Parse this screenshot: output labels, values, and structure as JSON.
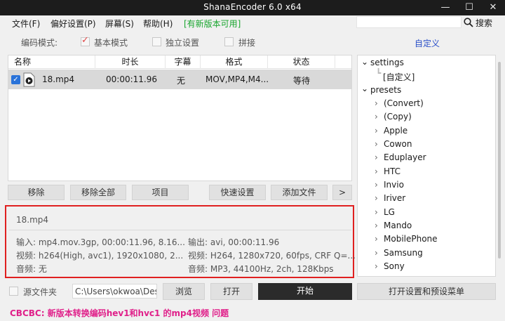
{
  "window": {
    "title": "ShanaEncoder 6.0 x64",
    "minimize": "—",
    "maximize": "☐",
    "close": "✕"
  },
  "menu": {
    "file": "文件(F)",
    "prefs": "偏好设置(P)",
    "screen": "屏幕(S)",
    "help": "帮助(H)",
    "update": "[有新版本可用]"
  },
  "search": {
    "value": "",
    "button": "搜索"
  },
  "mode": {
    "label": "编码模式:",
    "options": [
      {
        "label": "基本模式",
        "checked": true
      },
      {
        "label": "独立设置",
        "checked": false
      },
      {
        "label": "拼接",
        "checked": false
      }
    ],
    "custom_link": "自定义"
  },
  "filelist": {
    "columns": [
      "名称",
      "时长",
      "字幕",
      "格式",
      "状态"
    ],
    "rows": [
      {
        "name": "18.mp4",
        "duration": "00:00:11.96",
        "subtitle": "无",
        "format": "MOV,MP4,M4...",
        "status": "等待",
        "checked": true
      }
    ]
  },
  "actions": {
    "remove": "移除",
    "remove_all": "移除全部",
    "item": "项目",
    "quick_settings": "快速设置",
    "add_file": "添加文件",
    "more": ">"
  },
  "info": {
    "filename": "18.mp4",
    "input": "输入: mp4.mov.3gp, 00:00:11.96, 8.16...",
    "video_in": "视频: h264(High, avc1), 1920x1080, 2...",
    "audio_in": "音频: 无",
    "output": "输出: avi, 00:00:11.96",
    "video_out": "视频: H264, 1280x720, 60fps, CRF Q=...",
    "audio_out": "音频: MP3, 44100Hz, 2ch, 128Kbps"
  },
  "tree": {
    "settings": "settings",
    "custom": "[自定义]",
    "presets": "presets",
    "preset_items": [
      "(Convert)",
      "(Copy)",
      "Apple",
      "Cowon",
      "Eduplayer",
      "HTC",
      "Invio",
      "Iriver",
      "LG",
      "Mando",
      "MobilePhone",
      "Samsung",
      "Sony"
    ]
  },
  "bottom": {
    "source_folder": "源文件夹",
    "path": "C:\\Users\\okwoa\\Desk",
    "browse": "浏览",
    "open": "打开",
    "start": "开始",
    "open_settings": "打开设置和预设菜单"
  },
  "status_text": "CBCBC: 新版本转换编码hev1和hvc1 的mp4视频 问题",
  "colors": {
    "accent_blue": "#2a4fc8",
    "update_green": "#17a52d",
    "highlight_red": "#e02020",
    "status_pink": "#e0208a"
  }
}
